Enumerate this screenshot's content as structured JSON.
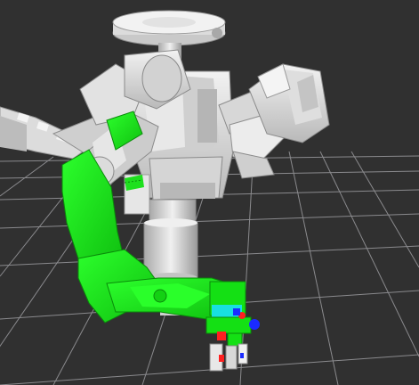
{
  "viewport": {
    "background_color": "#303030",
    "grid_color": "#a0a0a4",
    "visible": true
  },
  "scene": {
    "robot_base_color": "#e6e6e6",
    "robot_shade_color": "#bdbdbd",
    "robot_dark_color": "#8f8f8f",
    "highlight_color": "#16f016",
    "highlight_dark_color": "#0fb10f",
    "gripper_accent_colors": [
      "#1a2bff",
      "#ff2020",
      "#18e0e0",
      "#ffffff"
    ]
  }
}
